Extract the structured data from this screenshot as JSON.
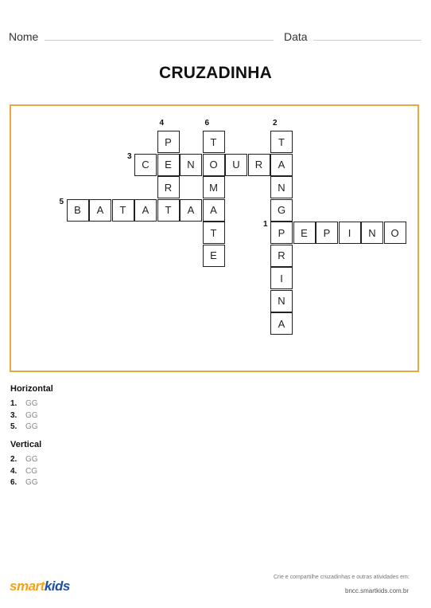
{
  "header": {
    "name_label": "Nome",
    "date_label": "Data"
  },
  "title": "CRUZADINHA",
  "grid": {
    "numbers": [
      {
        "n": "4",
        "r": 0,
        "c": 5
      },
      {
        "n": "6",
        "r": 0,
        "c": 7
      },
      {
        "n": "2",
        "r": 0,
        "c": 10
      },
      {
        "n": "3",
        "r": 1,
        "c": 3
      },
      {
        "n": "5",
        "r": 3,
        "c": 0
      },
      {
        "n": "1",
        "r": 4,
        "c": 9
      }
    ],
    "cells": [
      {
        "r": 0,
        "c": 5,
        "ch": "P"
      },
      {
        "r": 0,
        "c": 7,
        "ch": "T"
      },
      {
        "r": 0,
        "c": 10,
        "ch": "T"
      },
      {
        "r": 1,
        "c": 4,
        "ch": "C"
      },
      {
        "r": 1,
        "c": 5,
        "ch": "E"
      },
      {
        "r": 1,
        "c": 6,
        "ch": "N"
      },
      {
        "r": 1,
        "c": 7,
        "ch": "O"
      },
      {
        "r": 1,
        "c": 8,
        "ch": "U"
      },
      {
        "r": 1,
        "c": 9,
        "ch": "R"
      },
      {
        "r": 1,
        "c": 10,
        "ch": "A"
      },
      {
        "r": 2,
        "c": 5,
        "ch": "R"
      },
      {
        "r": 2,
        "c": 7,
        "ch": "M"
      },
      {
        "r": 2,
        "c": 10,
        "ch": "N"
      },
      {
        "r": 3,
        "c": 1,
        "ch": "B"
      },
      {
        "r": 3,
        "c": 2,
        "ch": "A"
      },
      {
        "r": 3,
        "c": 3,
        "ch": "T"
      },
      {
        "r": 3,
        "c": 4,
        "ch": "A"
      },
      {
        "r": 3,
        "c": 5,
        "ch": "T"
      },
      {
        "r": 3,
        "c": 6,
        "ch": "A"
      },
      {
        "r": 3,
        "c": 7,
        "ch": "A"
      },
      {
        "r": 3,
        "c": 10,
        "ch": "G"
      },
      {
        "r": 4,
        "c": 7,
        "ch": "T"
      },
      {
        "r": 4,
        "c": 10,
        "ch": "P"
      },
      {
        "r": 4,
        "c": 11,
        "ch": "E"
      },
      {
        "r": 4,
        "c": 12,
        "ch": "P"
      },
      {
        "r": 4,
        "c": 13,
        "ch": "I"
      },
      {
        "r": 4,
        "c": 14,
        "ch": "N"
      },
      {
        "r": 4,
        "c": 15,
        "ch": "O"
      },
      {
        "r": 5,
        "c": 7,
        "ch": "E"
      },
      {
        "r": 5,
        "c": 10,
        "ch": "R"
      },
      {
        "r": 6,
        "c": 10,
        "ch": "I"
      },
      {
        "r": 7,
        "c": 10,
        "ch": "N"
      },
      {
        "r": 8,
        "c": 10,
        "ch": "A"
      }
    ]
  },
  "clues": {
    "horizontal_title": "Horizontal",
    "horizontal": [
      {
        "n": "1.",
        "text": "GG"
      },
      {
        "n": "3.",
        "text": "GG"
      },
      {
        "n": "5.",
        "text": "GG"
      }
    ],
    "vertical_title": "Vertical",
    "vertical": [
      {
        "n": "2.",
        "text": "GG"
      },
      {
        "n": "4.",
        "text": "CG"
      },
      {
        "n": "6.",
        "text": "GG"
      }
    ]
  },
  "footer": {
    "logo_part1": "smart",
    "logo_part2": "kids",
    "tagline": "Crie e compartilhe cruzadinhas e outras atividades em:",
    "url": "bncc.smartkids.com.br"
  }
}
